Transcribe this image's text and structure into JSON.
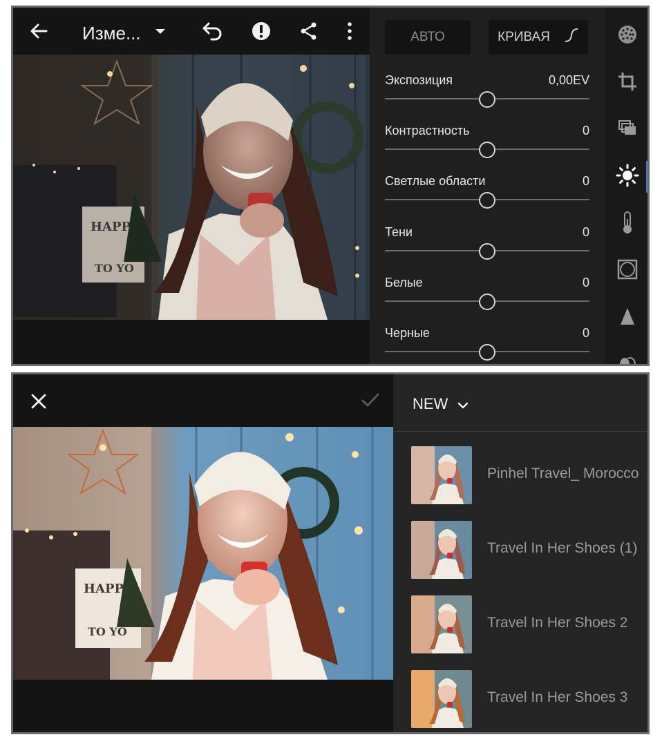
{
  "editor": {
    "title": "Изме...",
    "modes": {
      "auto": "АВТО",
      "curve": "КРИВАЯ"
    },
    "sliders": [
      {
        "label": "Экспозиция",
        "value": "0,00EV",
        "level": 0.5
      },
      {
        "label": "Контрастность",
        "value": "0",
        "level": 0.5
      },
      {
        "label": "Светлые области",
        "value": "0",
        "level": 0.5
      },
      {
        "label": "Тени",
        "value": "0",
        "level": 0.5
      },
      {
        "label": "Белые",
        "value": "0",
        "level": 0.5
      },
      {
        "label": "Черные",
        "value": "0",
        "level": 0.5
      }
    ],
    "toolbar_icons": [
      "back-arrow-icon",
      "dropdown-caret-icon",
      "undo-icon",
      "alert-icon",
      "share-icon",
      "more-vertical-icon"
    ],
    "rail_icons": [
      "presets-icon",
      "crop-icon",
      "versions-icon",
      "light-icon",
      "color-temperature-icon",
      "effects-vignette-icon",
      "detail-icon",
      "optics-icon"
    ],
    "active_rail": "light-icon",
    "accent": "#3f7fd0"
  },
  "presets": {
    "group": "NEW",
    "items": [
      {
        "name": "Pinhel Travel_ Morocco"
      },
      {
        "name": "Travel In Her Shoes (1)"
      },
      {
        "name": "Travel In Her Shoes 2"
      },
      {
        "name": "Travel In Her Shoes 3"
      }
    ]
  }
}
